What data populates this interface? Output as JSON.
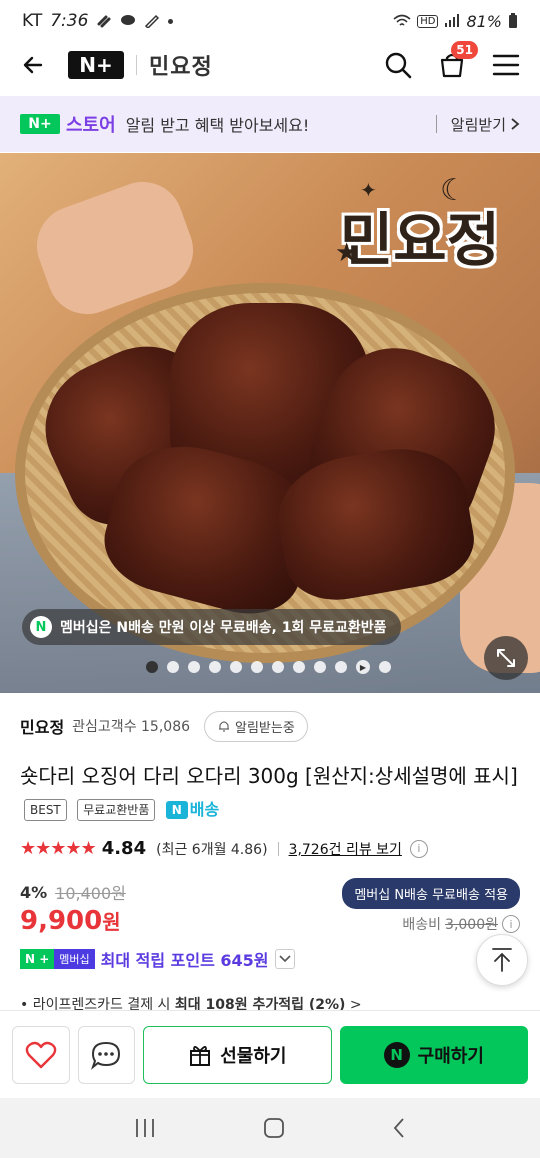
{
  "status": {
    "carrier": "KT",
    "time": "7:36",
    "battery": "81%"
  },
  "header": {
    "logo": "N+",
    "brand": "민요정",
    "cart_count": "51"
  },
  "promo": {
    "logo": "N+",
    "store": "스토어",
    "message": "알림 받고 혜택 받아보세요!",
    "alert_label": "알림받기"
  },
  "hero": {
    "logo_text": "민요정",
    "pill_icon": "N",
    "pill_text": "멤버십은 N배송 만원 이상 무료배송, 1회 무료교환반품",
    "slide_count": 12,
    "active_slide": 1
  },
  "store_row": {
    "name": "민요정",
    "followers": "관심고객수 15,086",
    "notify": "알림받는중"
  },
  "product": {
    "title": "숏다리 오징어 다리 오다리 300g [원산지:상세설명에 표시]",
    "tags": [
      "BEST",
      "무료교환반품"
    ],
    "n_delivery": "배송",
    "n_delivery_icon": "N",
    "stars": "★★★★★",
    "rating": "4.84",
    "recent_rating": "(최근 6개월 4.86)",
    "reviews": "3,726건 리뷰 보기",
    "discount": "4%",
    "original_price": "10,400원",
    "price_number": "9,900",
    "price_unit": "원",
    "member_pill": "멤버십 N배송 무료배송 적용",
    "shipping_label": "배송비",
    "shipping_fee": "3,000원",
    "np_g": "N +",
    "np_p": "멤버십",
    "points": "최대 적립 포인트 645원",
    "partial_line_pre": "• 라이프렌즈카드 결제 시 ",
    "partial_line_bold": "최대 108원 추가적립 (2%)",
    "partial_line_post": " >"
  },
  "actions": {
    "gift": "선물하기",
    "buy": "구매하기",
    "buy_icon": "N"
  },
  "colors": {
    "naver_green": "#03c75a",
    "price_red": "#e8353a",
    "store_purple": "#7b3fe4",
    "promo_bg": "#f1ecfb"
  },
  "icons": [
    "back-arrow-icon",
    "search-icon",
    "cart-icon",
    "menu-icon",
    "expand-icon",
    "heart-icon",
    "chat-icon",
    "gift-icon",
    "top-arrow-icon",
    "bell-icon",
    "info-icon"
  ]
}
